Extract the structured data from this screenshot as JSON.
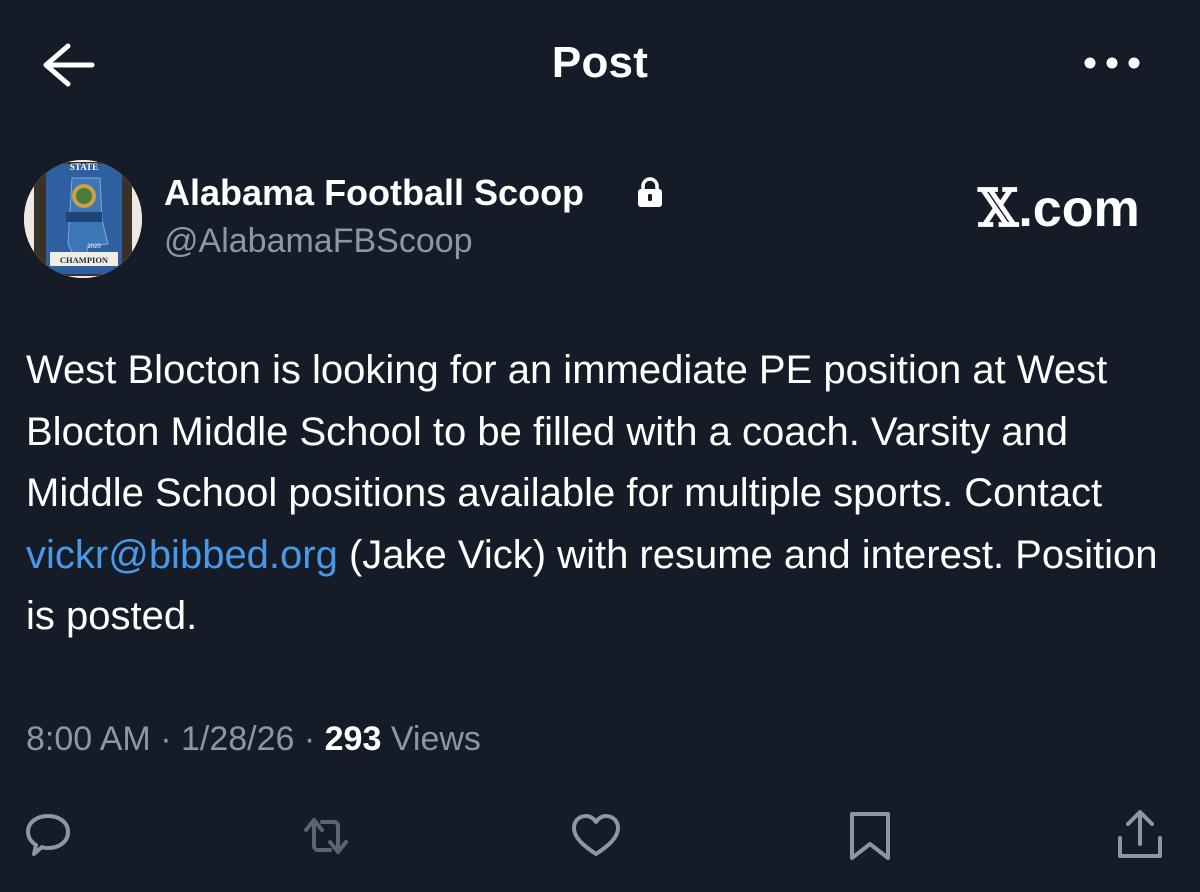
{
  "header": {
    "title": "Post"
  },
  "author": {
    "name": "Alabama Football Scoop",
    "handle": "@AlabamaFBScoop",
    "avatar": {
      "top_text": "STATE",
      "bottom_text": "CHAMPION",
      "year": "2020"
    }
  },
  "brand": {
    "x": "𝕏",
    "suffix": ".com"
  },
  "post": {
    "text_before": "West Blocton is looking for an immediate PE position at West Blocton Middle School to be filled with a coach. Varsity and Middle School positions available for multiple sports. Contact ",
    "link": "vickr@bibbed.org",
    "text_after": " (Jake Vick) with resume and interest. Position is posted."
  },
  "meta": {
    "time": "8:00 AM",
    "sep1": " · ",
    "date": "1/28/26",
    "sep2": " · ",
    "views_count": "293",
    "views_label": " Views"
  },
  "icons": {
    "back": "arrow-left-icon",
    "more": "more-horizontal-icon",
    "lock": "lock-icon",
    "reply": "reply-icon",
    "repost": "repost-icon",
    "like": "heart-icon",
    "bookmark": "bookmark-icon",
    "share": "share-icon"
  },
  "colors": {
    "background": "#151c27",
    "text": "#ffffff",
    "muted": "#8b97a4",
    "link": "#4a99e9"
  }
}
